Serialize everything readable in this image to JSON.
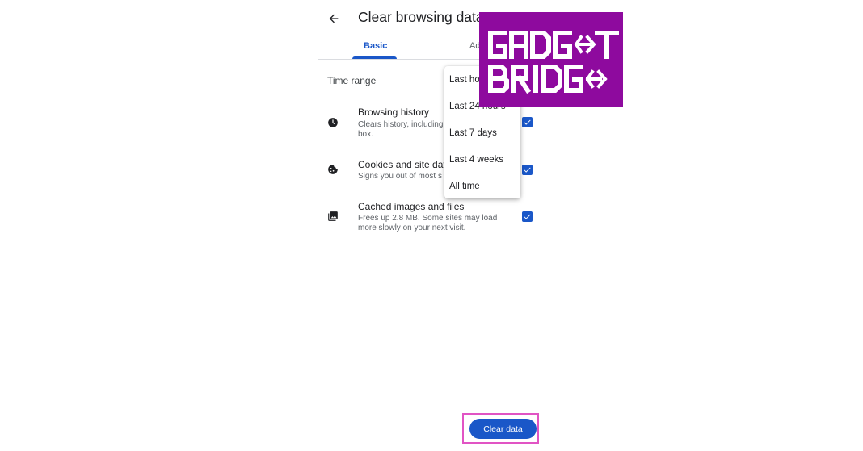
{
  "header": {
    "title": "Clear browsing data",
    "back_icon": "arrow-back-icon"
  },
  "tabs": [
    {
      "label": "Basic",
      "selected": true
    },
    {
      "label": "Ad",
      "selected": false
    }
  ],
  "time_range": {
    "label": "Time range",
    "options": [
      "Last hour",
      "Last 24 hours",
      "Last 7 days",
      "Last 4 weeks",
      "All time"
    ]
  },
  "rows": [
    {
      "icon": "clock-icon",
      "title": "Browsing history",
      "desc_1": "Clears history, including",
      "desc_2": "box.",
      "checked": true
    },
    {
      "icon": "cookie-icon",
      "title": "Cookies and site dat",
      "desc_1": "Signs you out of most s",
      "checked": true
    },
    {
      "icon": "image-icon",
      "title": "Cached images and files",
      "desc_1": "Frees up 2.8 MB. Some sites may load",
      "desc_2": "more slowly on your next visit.",
      "checked": true
    }
  ],
  "footer": {
    "clear_label": "Clear data"
  },
  "watermark": {
    "text": "GADGET BRIDGE",
    "color": "#8e0a9e"
  },
  "colors": {
    "accent": "#1a57c8",
    "highlight": "#e154c4"
  }
}
